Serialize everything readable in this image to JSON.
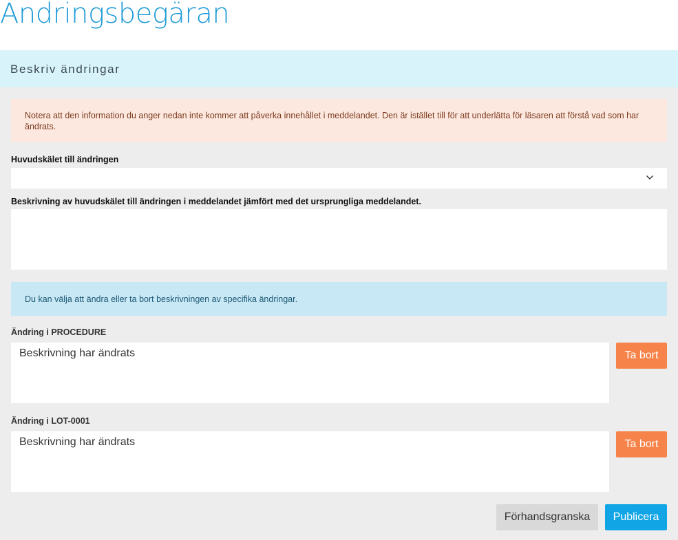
{
  "page": {
    "title": "Ändringsbegäran"
  },
  "section": {
    "title": "Beskriv ändringar"
  },
  "notices": {
    "warning": "Notera att den information du anger nedan inte kommer att påverka innehållet i meddelandet. Den är istället till för att underlätta för läsaren att förstå vad som har ändrats.",
    "info": "Du kan välja att ändra eller ta bort beskrivningen av specifika ändringar."
  },
  "form": {
    "main_reason_label": "Huvudskälet till ändringen",
    "main_reason_value": "",
    "description_label": "Beskrivning av huvudskälet till ändringen i meddelandet jämfört med det ursprungliga meddelandet.",
    "description_value": ""
  },
  "changes": [
    {
      "label": "Ändring i PROCEDURE",
      "value": "Beskrivning har ändrats",
      "remove_label": "Ta bort"
    },
    {
      "label": "Ändring i LOT-0001",
      "value": "Beskrivning har ändrats",
      "remove_label": "Ta bort"
    }
  ],
  "actions": {
    "preview_label": "Förhandsgranska",
    "publish_label": "Publicera"
  },
  "icons": {
    "select_toggle": "chevron-down-icon"
  },
  "colors": {
    "title": "#1f9bd8",
    "section_header_bg": "#d9f3fb",
    "panel_bg": "#ededed",
    "warning_bg": "#fde8df",
    "info_bg": "#c9e8f6",
    "remove_button": "#f6844a",
    "preview_button": "#d9d9d9",
    "publish_button": "#12a5e6"
  }
}
